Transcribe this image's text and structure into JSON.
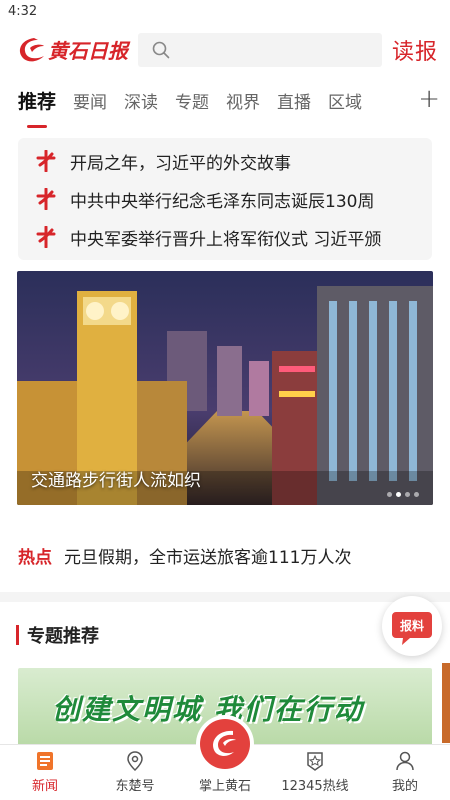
{
  "status_bar": {
    "time": "4:32"
  },
  "header": {
    "logo_text": "黄石日报",
    "read_label": "读报"
  },
  "tabs": [
    {
      "label": "推荐",
      "active": true
    },
    {
      "label": "要闻"
    },
    {
      "label": "深读"
    },
    {
      "label": "专题"
    },
    {
      "label": "视界"
    },
    {
      "label": "直播"
    },
    {
      "label": "区域"
    }
  ],
  "headlines": [
    "开局之年，习近平的外交故事",
    "中共中央举行纪念毛泽东同志诞辰130周",
    "中央军委举行晋升上将军衔仪式 习近平颁"
  ],
  "banner": {
    "caption": "交通路步行街人流如织",
    "dots": 4,
    "active_dot": 1
  },
  "hot": {
    "tag": "热点",
    "text": "元旦假期，全市运送旅客逾111万人次"
  },
  "section": {
    "title": "专题推荐"
  },
  "promo": {
    "text": "创建文明城  我们在行动"
  },
  "fab": {
    "label": "报料"
  },
  "tabbar": [
    {
      "label": "新闻",
      "icon": "news-icon",
      "active": true
    },
    {
      "label": "东楚号",
      "icon": "location-pin-icon"
    },
    {
      "label": "掌上黄石",
      "icon": "brand-logo-icon"
    },
    {
      "label": "12345热线",
      "icon": "hotline-badge-icon"
    },
    {
      "label": "我的",
      "icon": "user-icon"
    }
  ],
  "colors": {
    "accent": "#d7252a",
    "promo_green": "#1f8a3a"
  }
}
